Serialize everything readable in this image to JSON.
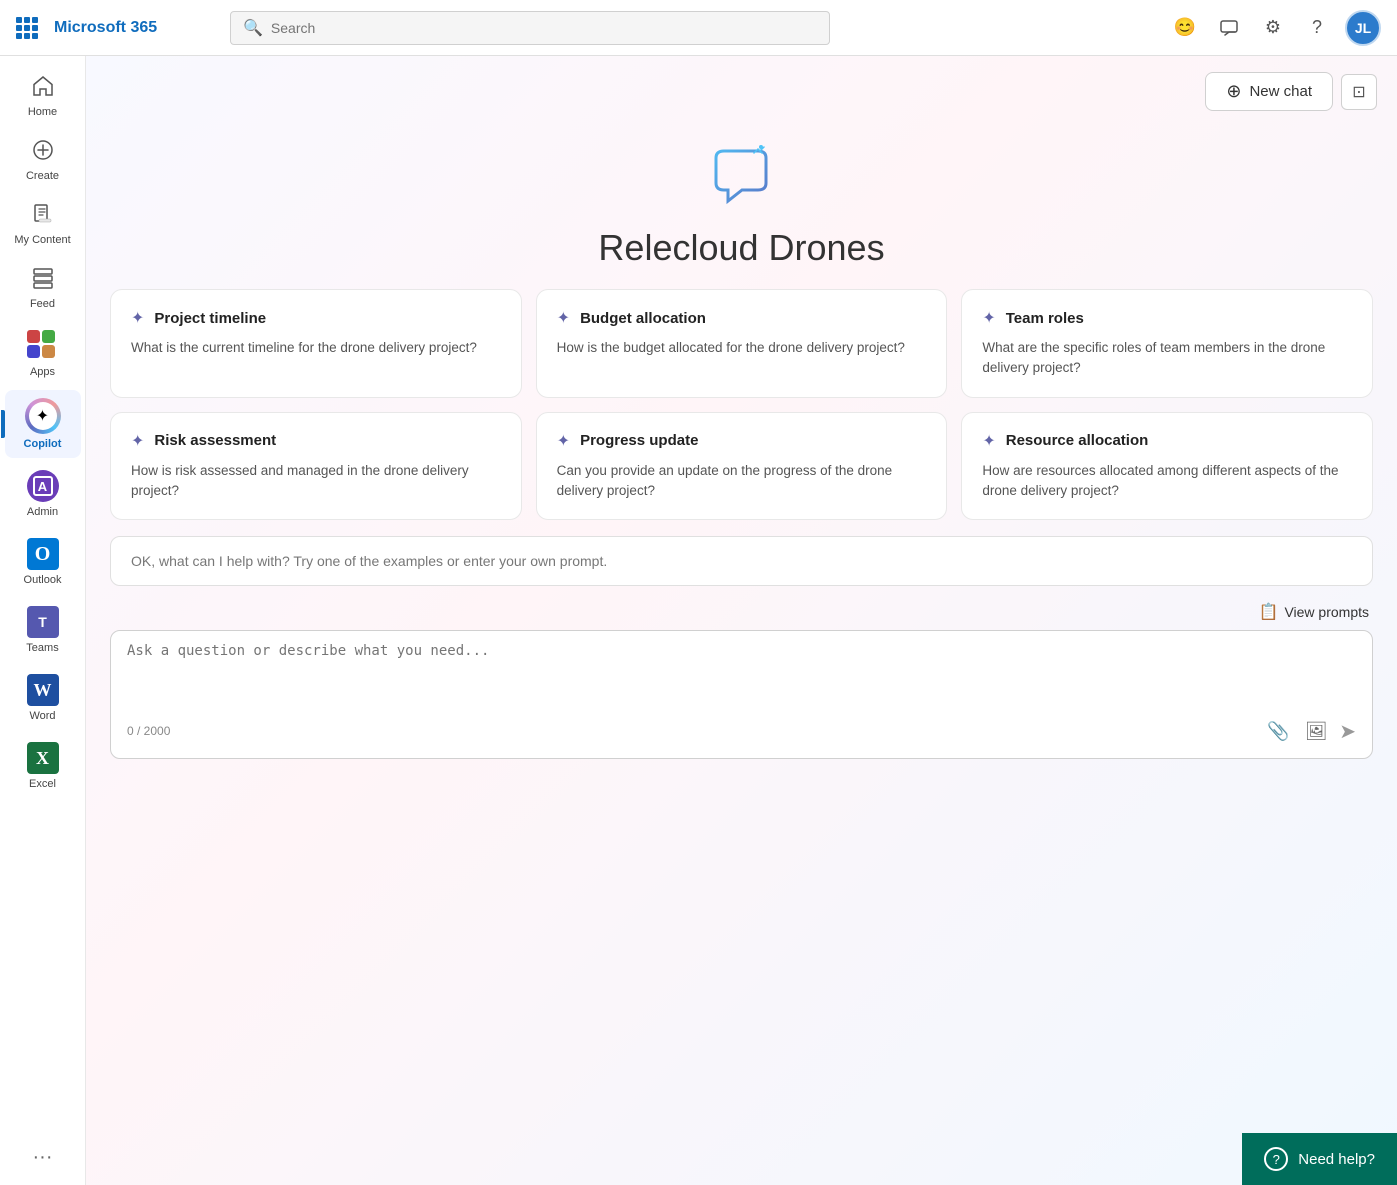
{
  "app": {
    "name": "Microsoft 365",
    "avatar_initials": "JL"
  },
  "search": {
    "placeholder": "Search"
  },
  "topbar": {
    "emoji_label": "😊",
    "feedback_label": "✏",
    "settings_label": "⚙",
    "help_label": "?"
  },
  "sidebar": {
    "items": [
      {
        "id": "home",
        "label": "Home",
        "icon": "home"
      },
      {
        "id": "create",
        "label": "Create",
        "icon": "create"
      },
      {
        "id": "my-content",
        "label": "My Content",
        "icon": "content"
      },
      {
        "id": "feed",
        "label": "Feed",
        "icon": "feed"
      },
      {
        "id": "apps",
        "label": "Apps",
        "icon": "apps"
      },
      {
        "id": "copilot",
        "label": "Copilot",
        "icon": "copilot",
        "active": true
      },
      {
        "id": "admin",
        "label": "Admin",
        "icon": "admin"
      },
      {
        "id": "outlook",
        "label": "Outlook",
        "icon": "outlook"
      },
      {
        "id": "teams",
        "label": "Teams",
        "icon": "teams"
      },
      {
        "id": "word",
        "label": "Word",
        "icon": "word"
      },
      {
        "id": "excel",
        "label": "Excel",
        "icon": "excel"
      }
    ],
    "more_label": "···"
  },
  "header": {
    "new_chat_label": "New chat",
    "expand_icon": "⊡"
  },
  "hero": {
    "title": "Relecloud Drones"
  },
  "cards": [
    {
      "id": "project-timeline",
      "title": "Project timeline",
      "desc": "What is the current timeline for the drone delivery project?"
    },
    {
      "id": "budget-allocation",
      "title": "Budget allocation",
      "desc": "How is the budget allocated for the drone delivery project?"
    },
    {
      "id": "team-roles",
      "title": "Team roles",
      "desc": "What are the specific roles of team members in the drone delivery project?"
    },
    {
      "id": "risk-assessment",
      "title": "Risk assessment",
      "desc": "How is risk assessed and managed in the drone delivery project?"
    },
    {
      "id": "progress-update",
      "title": "Progress update",
      "desc": "Can you provide an update on the progress of the drone delivery project?"
    },
    {
      "id": "resource-allocation",
      "title": "Resource allocation",
      "desc": "How are resources allocated among different aspects of the drone delivery project?"
    }
  ],
  "prompt_placeholder": "OK, what can I help with? Try one of the examples or enter your own prompt.",
  "view_prompts_label": "View prompts",
  "input": {
    "char_count": "0 / 2000",
    "placeholder": "Ask a question or describe what you need..."
  },
  "need_help": {
    "label": "Need help?"
  }
}
